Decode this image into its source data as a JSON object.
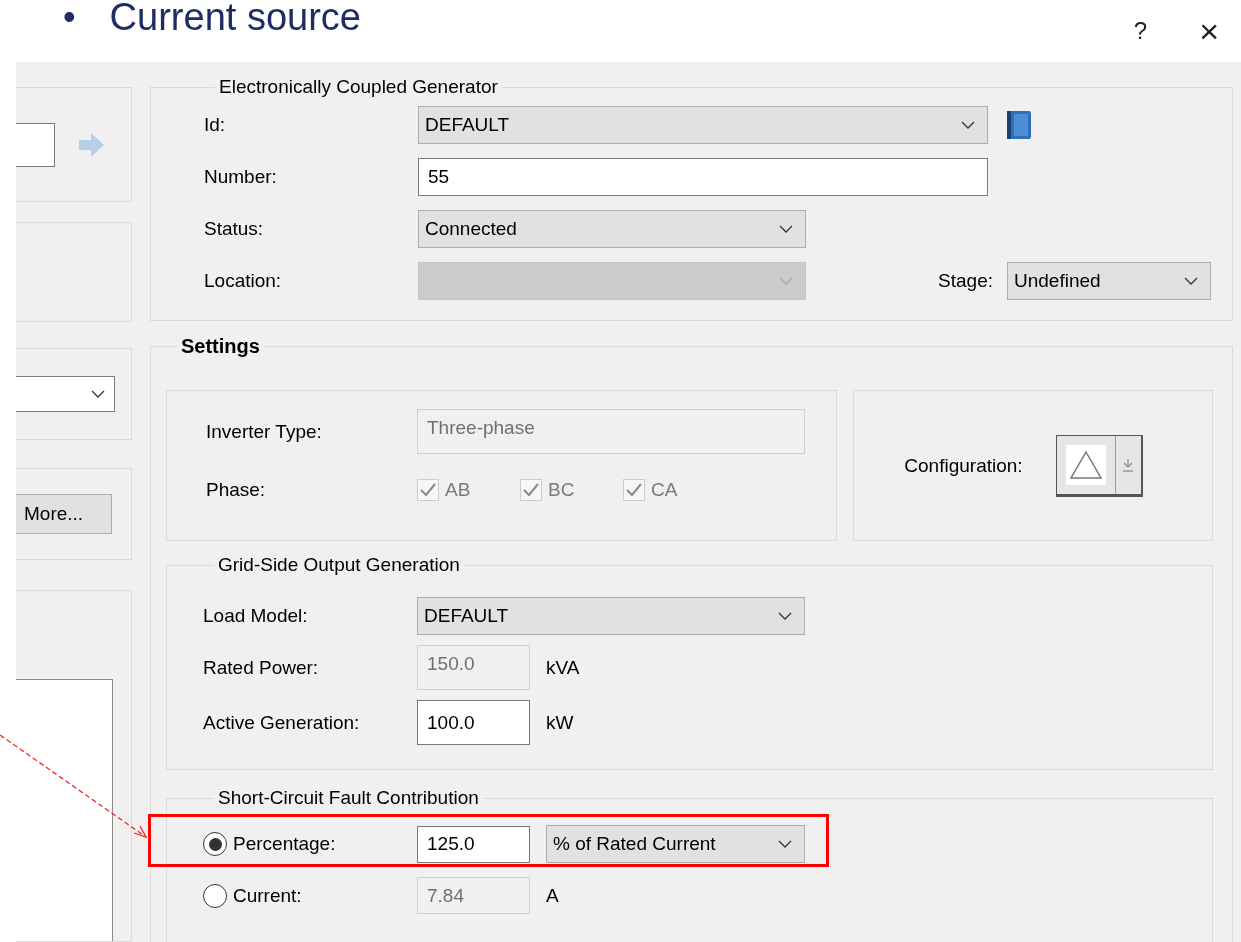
{
  "slide": {
    "bullet": "•",
    "title": "Current source"
  },
  "dialog_buttons": [
    {
      "label": "?",
      "kind": "help"
    },
    {
      "label": "×",
      "kind": "close"
    }
  ],
  "left_panel": {
    "more_button": "More..."
  },
  "generator": {
    "title": "Electronically Coupled Generator",
    "fields": [
      {
        "label": "Id:",
        "kind": "dropdown",
        "value": "DEFAULT",
        "disabled": false
      },
      {
        "label": "Number:",
        "kind": "input",
        "value": "55",
        "disabled": false
      },
      {
        "label": "Status:",
        "kind": "dropdown",
        "value": "Connected",
        "disabled": false
      },
      {
        "label": "Location:",
        "kind": "dropdown",
        "disabled": true
      }
    ],
    "stage": {
      "label": "Stage:",
      "value": "Undefined"
    }
  },
  "settings": {
    "title": "Settings",
    "inverter_type": {
      "label": "Inverter Type:",
      "value": "Three-phase",
      "disabled": true
    },
    "phase": {
      "label": "Phase:",
      "options": [
        {
          "label": "AB",
          "checked": true,
          "disabled": true
        },
        {
          "label": "BC",
          "checked": true,
          "disabled": true
        },
        {
          "label": "CA",
          "checked": true,
          "disabled": true
        }
      ]
    },
    "configuration": {
      "label": "Configuration:"
    }
  },
  "grid_side": {
    "title": "Grid-Side Output Generation",
    "load_model": {
      "label": "Load Model:",
      "value": "DEFAULT"
    },
    "rated_power": {
      "label": "Rated Power:",
      "value": "150.0",
      "unit": "kVA",
      "disabled": true
    },
    "active_generation": {
      "label": "Active Generation:",
      "value": "100.0",
      "unit": "kW",
      "disabled": false
    }
  },
  "fault": {
    "title": "Short-Circuit Fault Contribution",
    "highlighted": true,
    "options": [
      {
        "label": "Percentage:",
        "selected": true,
        "value": "125.0",
        "disabled": false,
        "basis": "% of Rated Current"
      },
      {
        "label": "Current:",
        "selected": false,
        "value": "7.84",
        "disabled": true,
        "unit": "A"
      }
    ]
  }
}
